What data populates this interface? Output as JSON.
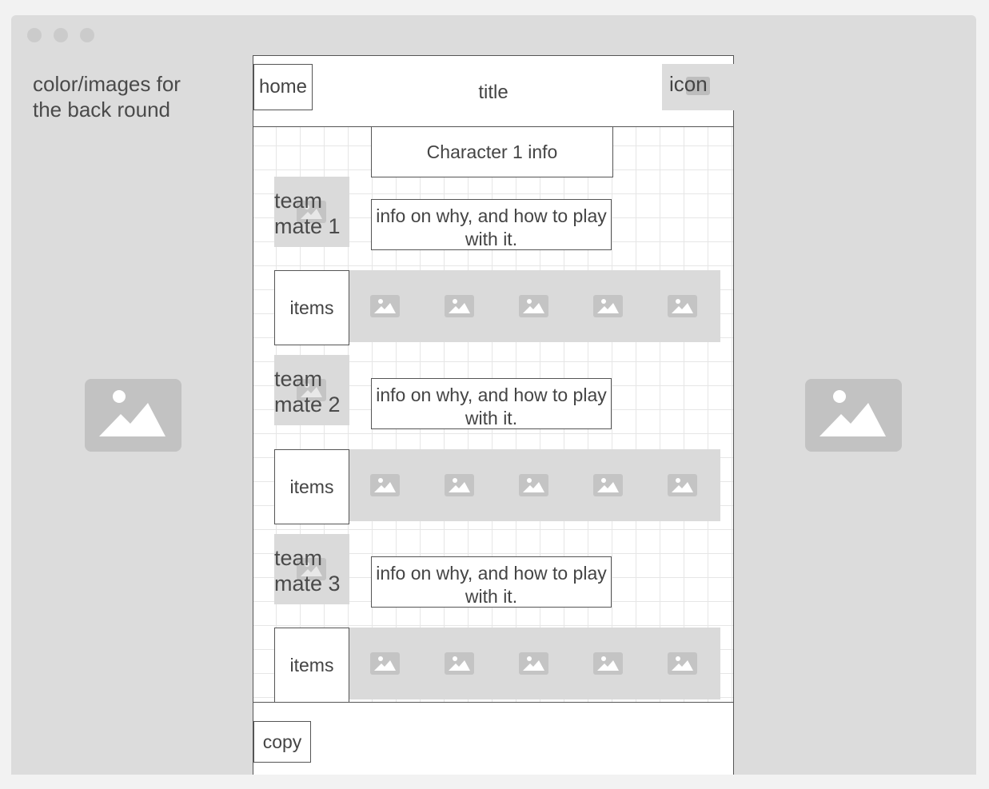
{
  "background_note": "color/images for the back round",
  "header": {
    "home_label": "home",
    "title": "title",
    "icon_label": "icon"
  },
  "character_info": "Character 1 info",
  "sections": [
    {
      "teammate": "team mate 1",
      "info": "info on why, and how to play with it.",
      "items_label": "items",
      "item_icons": [
        "image-icon",
        "image-icon",
        "image-icon",
        "image-icon",
        "image-icon"
      ]
    },
    {
      "teammate": "team mate 2",
      "info": "info on why, and how to play with it.",
      "items_label": "items",
      "item_icons": [
        "image-icon",
        "image-icon",
        "image-icon",
        "image-icon",
        "image-icon"
      ]
    },
    {
      "teammate": "team mate 3",
      "info": "info on why, and how to play with it.",
      "items_label": "items",
      "item_icons": [
        "image-icon",
        "image-icon",
        "image-icon",
        "image-icon",
        "image-icon"
      ]
    }
  ],
  "footer": {
    "copy_label": "copy"
  },
  "colors": {
    "placeholder": "#d9d9d9",
    "placeholder_icon": "#bdbdbd",
    "border": "#555555",
    "window": "#dcdcdc"
  }
}
